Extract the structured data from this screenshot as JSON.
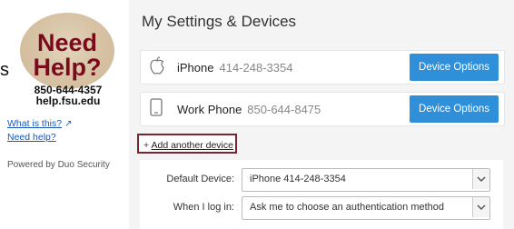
{
  "sidebar": {
    "edge_mark": "s",
    "logo": {
      "line1": "Need",
      "line2": "Help?",
      "phone": "850-644-4357",
      "site": "help.fsu.edu"
    },
    "what_is_this": "What is this?",
    "need_help": "Need help?",
    "powered_by": "Powered by Duo Security"
  },
  "main": {
    "title": "My Settings & Devices",
    "devices": [
      {
        "icon": "apple-icon",
        "name": "iPhone",
        "number": "414-248-3354",
        "button": "Device Options"
      },
      {
        "icon": "phone-icon",
        "name": "Work Phone",
        "number": "850-644-8475",
        "button": "Device Options"
      }
    ],
    "add_device": {
      "prefix": "+",
      "label": "Add another device"
    },
    "settings": {
      "default_device_label": "Default Device:",
      "default_device_value": "iPhone 414-248-3354",
      "login_label": "When I log in:",
      "login_value": "Ask me to choose an authentication method"
    }
  },
  "colors": {
    "accent": "#2f8fd8",
    "brand": "#7a0a1c",
    "highlight_border": "#7b2532",
    "link": "#1a57b5"
  }
}
